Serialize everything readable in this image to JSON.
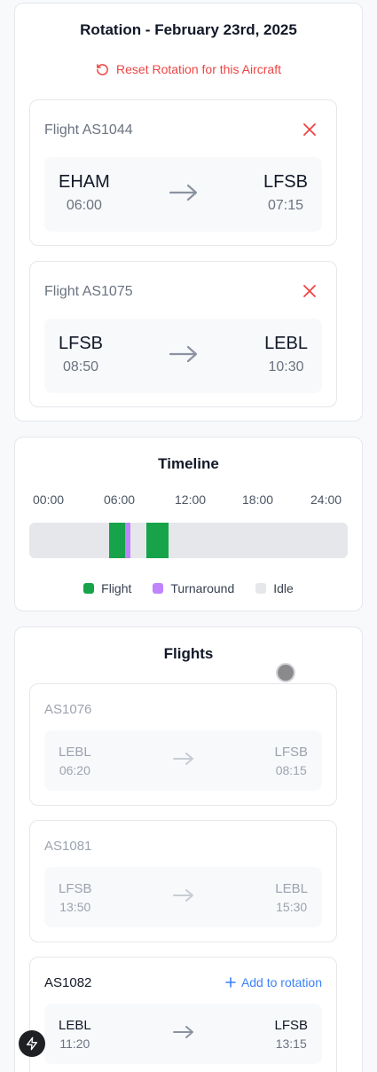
{
  "rotation": {
    "title": "Rotation - February 23rd, 2025",
    "reset_label": "Reset Rotation for this Aircraft",
    "flights": [
      {
        "label": "Flight AS1044",
        "from": "EHAM",
        "dep": "06:00",
        "to": "LFSB",
        "arr": "07:15"
      },
      {
        "label": "Flight AS1075",
        "from": "LFSB",
        "dep": "08:50",
        "to": "LEBL",
        "arr": "10:30"
      }
    ]
  },
  "timeline": {
    "title": "Timeline",
    "labels": [
      "00:00",
      "06:00",
      "12:00",
      "18:00",
      "24:00"
    ],
    "segments": [
      {
        "type": "flight",
        "start_hour": 6.0,
        "end_hour": 7.25
      },
      {
        "type": "turnaround",
        "start_hour": 7.25,
        "end_hour": 7.6
      },
      {
        "type": "flight",
        "start_hour": 8.83,
        "end_hour": 10.5
      }
    ],
    "legend": {
      "flight": "Flight",
      "turnaround": "Turnaround",
      "idle": "Idle"
    },
    "colors": {
      "flight": "#16a34a",
      "turnaround": "#c084fc",
      "idle": "#e5e7eb"
    }
  },
  "flights": {
    "title": "Flights",
    "list": [
      {
        "id": "AS1076",
        "from": "LEBL",
        "dep": "06:20",
        "to": "LFSB",
        "arr": "08:15"
      },
      {
        "id": "AS1081",
        "from": "LFSB",
        "dep": "13:50",
        "to": "LEBL",
        "arr": "15:30"
      },
      {
        "id": "AS1082",
        "from": "LEBL",
        "dep": "11:20",
        "to": "LFSB",
        "arr": "13:15",
        "action": "Add to rotation"
      }
    ]
  }
}
